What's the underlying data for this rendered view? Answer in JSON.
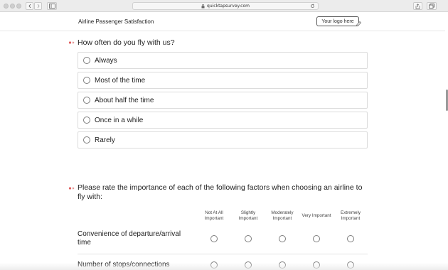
{
  "browser": {
    "url": "quicktapsurvey.com"
  },
  "header": {
    "survey_title": "Airline Passenger Satisfaction",
    "logo_text": "Your logo here"
  },
  "question1": {
    "title": "How often do you fly with us?",
    "options": [
      "Always",
      "Most of the time",
      "About half the time",
      "Once in a while",
      "Rarely"
    ]
  },
  "question2": {
    "title_line1": "Please rate the importance of each of the following factors when choosing an airline to",
    "title_line2": "fly with:",
    "columns": [
      {
        "line1": "Not At All",
        "line2": "Important"
      },
      {
        "line1": "Slightly",
        "line2": "Important"
      },
      {
        "line1": "Moderately",
        "line2": "Important"
      },
      {
        "line1": "Very Important",
        "line2": ""
      },
      {
        "line1": "Extremely",
        "line2": "Important"
      }
    ],
    "rows": [
      {
        "line1": "Convenience of departure/arrival",
        "line2": "time"
      },
      {
        "line1": "Number of stops/connections",
        "line2": ""
      }
    ]
  },
  "colors": {
    "marker": "#e06060",
    "border": "#dcdcdc"
  }
}
